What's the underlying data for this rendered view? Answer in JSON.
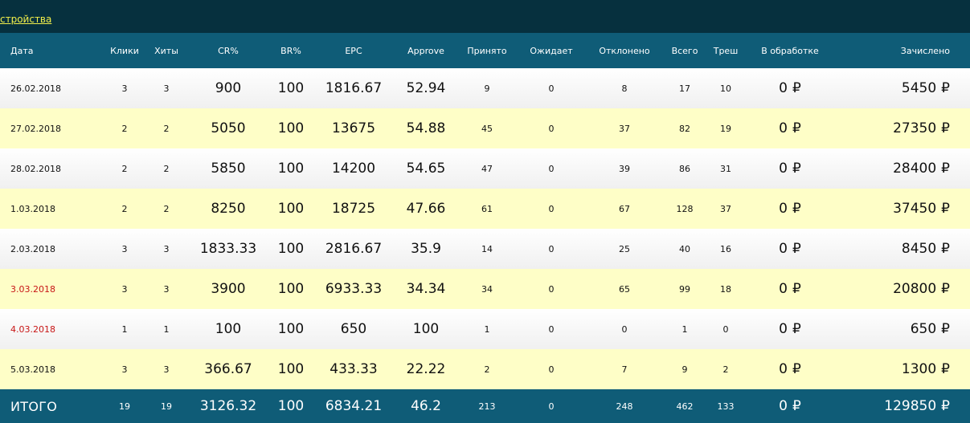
{
  "topbar": {
    "link_text": "стройства"
  },
  "headers": [
    "Дата",
    "Клики",
    "Хиты",
    "CR%",
    "BR%",
    "EPC",
    "Approve",
    "Принято",
    "Ожидает",
    "Отклонено",
    "Всего",
    "Треш",
    "В обработке",
    "Зачислено"
  ],
  "currency_symbol": "₽",
  "rows": [
    {
      "date": "26.02.2018",
      "clicks": "3",
      "hits": "3",
      "cr": "900",
      "br": "100",
      "epc": "1816.67",
      "approve": "52.94",
      "accepted": "9",
      "pending": "0",
      "rejected": "8",
      "total": "17",
      "trash": "10",
      "processing": "0",
      "credited": "5450",
      "weekend": false
    },
    {
      "date": "27.02.2018",
      "clicks": "2",
      "hits": "2",
      "cr": "5050",
      "br": "100",
      "epc": "13675",
      "approve": "54.88",
      "accepted": "45",
      "pending": "0",
      "rejected": "37",
      "total": "82",
      "trash": "19",
      "processing": "0",
      "credited": "27350",
      "weekend": false
    },
    {
      "date": "28.02.2018",
      "clicks": "2",
      "hits": "2",
      "cr": "5850",
      "br": "100",
      "epc": "14200",
      "approve": "54.65",
      "accepted": "47",
      "pending": "0",
      "rejected": "39",
      "total": "86",
      "trash": "31",
      "processing": "0",
      "credited": "28400",
      "weekend": false
    },
    {
      "date": "1.03.2018",
      "clicks": "2",
      "hits": "2",
      "cr": "8250",
      "br": "100",
      "epc": "18725",
      "approve": "47.66",
      "accepted": "61",
      "pending": "0",
      "rejected": "67",
      "total": "128",
      "trash": "37",
      "processing": "0",
      "credited": "37450",
      "weekend": false
    },
    {
      "date": "2.03.2018",
      "clicks": "3",
      "hits": "3",
      "cr": "1833.33",
      "br": "100",
      "epc": "2816.67",
      "approve": "35.9",
      "accepted": "14",
      "pending": "0",
      "rejected": "25",
      "total": "40",
      "trash": "16",
      "processing": "0",
      "credited": "8450",
      "weekend": false
    },
    {
      "date": "3.03.2018",
      "clicks": "3",
      "hits": "3",
      "cr": "3900",
      "br": "100",
      "epc": "6933.33",
      "approve": "34.34",
      "accepted": "34",
      "pending": "0",
      "rejected": "65",
      "total": "99",
      "trash": "18",
      "processing": "0",
      "credited": "20800",
      "weekend": true
    },
    {
      "date": "4.03.2018",
      "clicks": "1",
      "hits": "1",
      "cr": "100",
      "br": "100",
      "epc": "650",
      "approve": "100",
      "accepted": "1",
      "pending": "0",
      "rejected": "0",
      "total": "1",
      "trash": "0",
      "processing": "0",
      "credited": "650",
      "weekend": true
    },
    {
      "date": "5.03.2018",
      "clicks": "3",
      "hits": "3",
      "cr": "366.67",
      "br": "100",
      "epc": "433.33",
      "approve": "22.22",
      "accepted": "2",
      "pending": "0",
      "rejected": "7",
      "total": "9",
      "trash": "2",
      "processing": "0",
      "credited": "1300",
      "weekend": false
    }
  ],
  "totals": {
    "label": "ИТОГО",
    "clicks": "19",
    "hits": "19",
    "cr": "3126.32",
    "br": "100",
    "epc": "6834.21",
    "approve": "46.2",
    "accepted": "213",
    "pending": "0",
    "rejected": "248",
    "total": "462",
    "trash": "133",
    "processing": "0",
    "credited": "129850"
  },
  "colors": {
    "topbar": "#06303e",
    "header": "#0f5c77",
    "row_alt": "#fefec7",
    "weekend_date": "#c81616",
    "link": "#f2ef4a"
  }
}
